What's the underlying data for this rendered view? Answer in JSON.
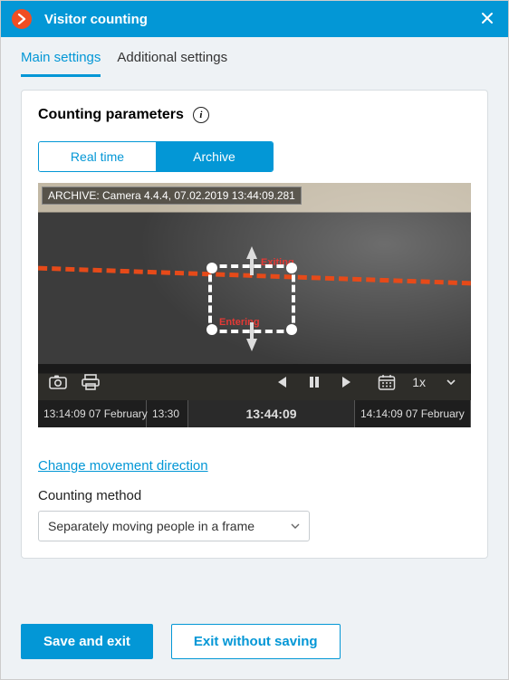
{
  "window": {
    "title": "Visitor counting"
  },
  "tabs": {
    "main": "Main settings",
    "additional": "Additional settings",
    "active": "main"
  },
  "card": {
    "title": "Counting parameters"
  },
  "segmented": {
    "realtime": "Real time",
    "archive": "Archive",
    "active": "archive"
  },
  "video": {
    "overlay_label": "ARCHIVE: Camera 4.4.4, 07.02.2019 13:44:09.281",
    "annotations": {
      "entering": "Entering",
      "exiting": "Exiting"
    },
    "speed": "1x",
    "timeline": {
      "start": "13:14:09 07 February",
      "tick1": "13:30",
      "current": "13:44:09",
      "end": "14:14:09 07 February"
    }
  },
  "link": {
    "change_direction": "Change movement direction"
  },
  "counting_method": {
    "label": "Counting method",
    "value": "Separately moving people in a frame"
  },
  "footer": {
    "save": "Save and exit",
    "exit": "Exit without saving"
  }
}
